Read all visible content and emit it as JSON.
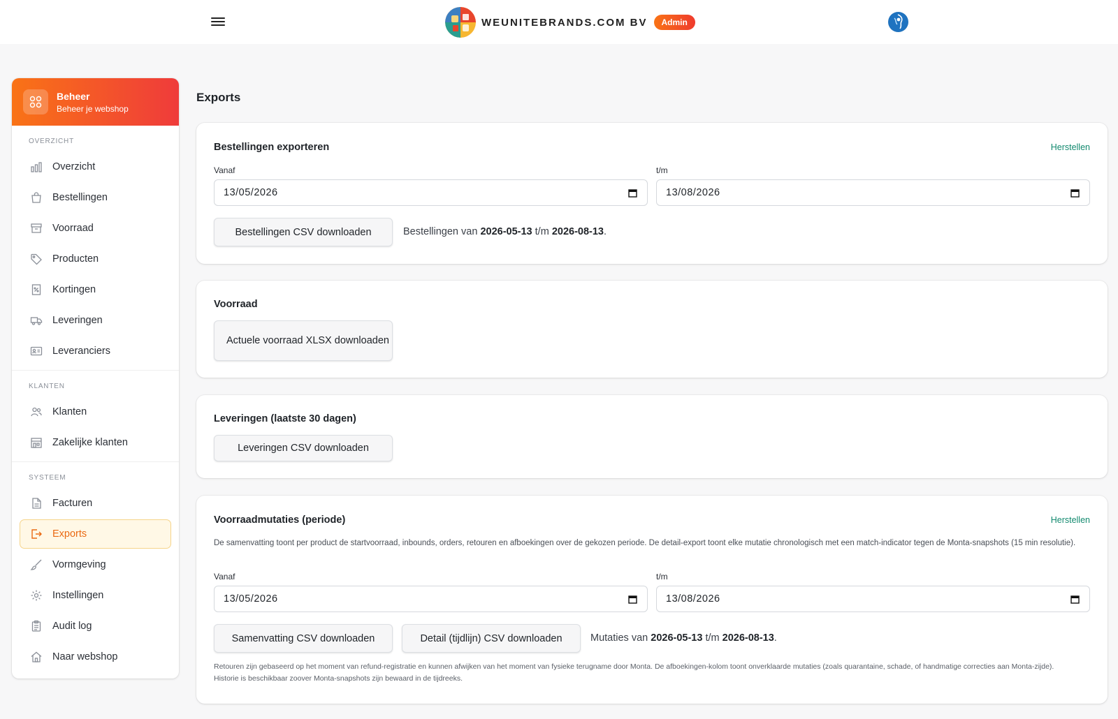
{
  "header": {
    "brand_name": "WEUNITEBRANDS.COM BV",
    "badge": "Admin",
    "menu_icon": "hamburger-menu-icon",
    "profile_icon": "globe-avatar-icon",
    "accent_color": "#f97316"
  },
  "sidebar": {
    "title": "Beheer",
    "subtitle": "Beheer je webshop",
    "sections": [
      {
        "label": "OVERZICHT",
        "items": [
          {
            "label": "Overzicht",
            "icon": "bar-chart-icon"
          },
          {
            "label": "Bestellingen",
            "icon": "shopping-bag-icon"
          },
          {
            "label": "Voorraad",
            "icon": "archive-box-icon"
          },
          {
            "label": "Producten",
            "icon": "tag-icon"
          },
          {
            "label": "Kortingen",
            "icon": "discount-receipt-icon"
          },
          {
            "label": "Leveringen",
            "icon": "truck-icon"
          },
          {
            "label": "Leveranciers",
            "icon": "id-card-icon"
          }
        ]
      },
      {
        "label": "KLANTEN",
        "items": [
          {
            "label": "Klanten",
            "icon": "users-icon"
          },
          {
            "label": "Zakelijke klanten",
            "icon": "building-icon"
          }
        ]
      },
      {
        "label": "SYSTEEM",
        "items": [
          {
            "label": "Facturen",
            "icon": "document-icon"
          },
          {
            "label": "Exports",
            "icon": "export-icon",
            "active": true
          },
          {
            "label": "Vormgeving",
            "icon": "brush-icon"
          },
          {
            "label": "Instellingen",
            "icon": "gear-icon"
          },
          {
            "label": "Audit log",
            "icon": "clipboard-icon"
          },
          {
            "label": "Naar webshop",
            "icon": "home-icon"
          }
        ]
      }
    ]
  },
  "main": {
    "title": "Exports",
    "orders": {
      "title": "Bestellingen exporteren",
      "reset": "Herstellen",
      "from_label": "Vanaf",
      "to_label": "t/m",
      "from_value": "13/05/2026",
      "to_value": "13/08/2026",
      "button": "Bestellingen CSV downloaden",
      "summary_prefix": "Bestellingen van",
      "summary_from": "2026-05-13",
      "summary_mid": "t/m",
      "summary_to": "2026-08-13",
      "summary_end": "."
    },
    "stock": {
      "title": "Voorraad",
      "button": "Actuele voorraad XLSX downloaden"
    },
    "deliveries": {
      "title": "Leveringen (laatste 30 dagen)",
      "button": "Leveringen CSV downloaden"
    },
    "mutations": {
      "title": "Voorraadmutaties (periode)",
      "reset": "Herstellen",
      "description": "De samenvatting toont per product de startvoorraad, inbounds, orders, retouren en afboekingen over de gekozen periode. De detail-export toont elke mutatie chronologisch met een match-indicator tegen de Monta-snapshots (15 min resolutie).",
      "from_label": "Vanaf",
      "to_label": "t/m",
      "from_value": "13/05/2026",
      "to_value": "13/08/2026",
      "button_summary": "Samenvatting CSV downloaden",
      "button_detail": "Detail (tijdlijn) CSV downloaden",
      "summary_prefix": "Mutaties van",
      "summary_from": "2026-05-13",
      "summary_mid": "t/m",
      "summary_to": "2026-08-13",
      "summary_end": ".",
      "note": "Retouren zijn gebaseerd op het moment van refund-registratie en kunnen afwijken van het moment van fysieke terugname door Monta. De afboekingen-kolom toont onverklaarde mutaties (zoals quarantaine, schade, of handmatige correcties aan Monta-zijde). Historie is beschikbaar zoover Monta-snapshots zijn bewaard in de tijdreeks."
    }
  }
}
